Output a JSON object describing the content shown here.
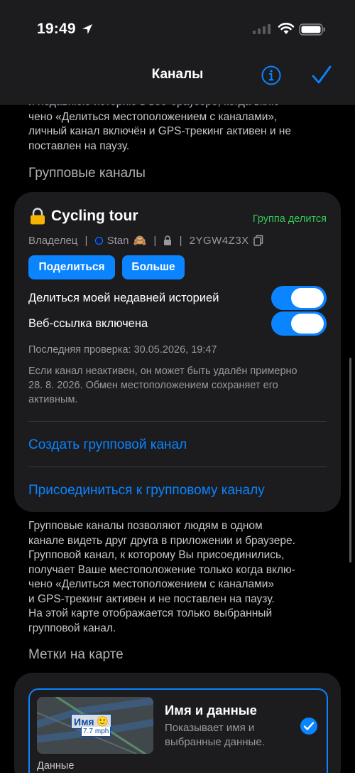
{
  "status_bar": {
    "time": "19:49"
  },
  "nav": {
    "title": "Каналы",
    "info_icon": "info-circle-icon",
    "done_icon": "checkmark-icon"
  },
  "intro_text": "и недавнюю историю в веб-браузере, когда вклю-\nчено «Делиться местоположением с каналами»,\nличный канал включён и GPS-трекинг активен и не\nпоставлен на паузу.",
  "group_channels": {
    "header": "Групповые каналы",
    "channel": {
      "name": "Cycling tour",
      "share_status": "Группа делится",
      "owner_label": "Владелец",
      "owner_name": "Stan",
      "owner_emoji": "🙈",
      "code": "2YGW4Z3X",
      "share_button": "Поделиться",
      "more_button": "Больше",
      "share_history_label": "Делиться моей недавней историей",
      "share_history_on": true,
      "weblink_label": "Веб-ссылка включена",
      "weblink_on": true,
      "last_check": "Последняя проверка: 30.05.2026, 19:47",
      "inactive_note": "Если канал неактивен, он может быть удалён примерно\n28. 8. 2026. Обмен местоположением сохраняет его\nактивным."
    },
    "create_link": "Создать групповой канал",
    "join_link": "Присоединиться к групповому каналу",
    "description": "Групповые каналы позволяют людям в одном\nканале видеть друг друга в приложении и браузере.\nГрупповой канал, к которому Вы присоединились,\nполучает Ваше местоположение только когда вклю-\nчено «Делиться местоположением с каналами»\nи GPS-трекинг активен и не поставлен на паузу.\nНа этой карте отображается только выбранный\nгрупповой канал."
  },
  "map_markers": {
    "header": "Метки на карте",
    "option": {
      "name": "Имя и данные",
      "description": "Показывает имя и выбранные данные.",
      "preview_name": "Имя",
      "preview_emoji": "🙂",
      "preview_value": "7.7",
      "preview_unit": "mph",
      "selected": true,
      "data_label": "Данные"
    }
  },
  "colors": {
    "accent": "#0a84ff",
    "green": "#34c759",
    "card": "#1c1c1e",
    "background": "#000000"
  }
}
